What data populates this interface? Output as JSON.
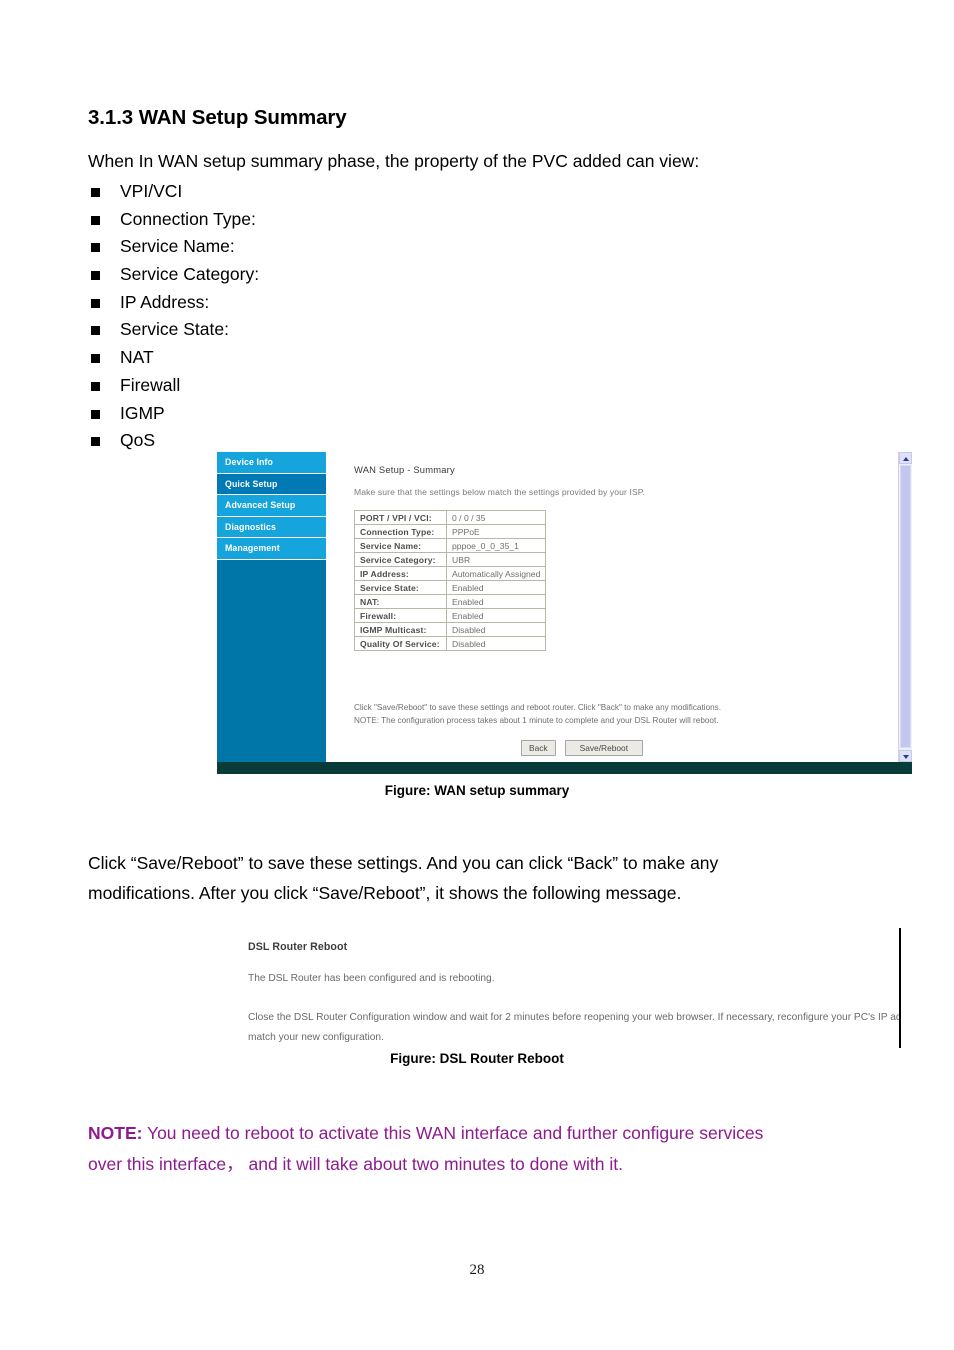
{
  "document": {
    "heading": "3.1.3 WAN Setup Summary",
    "intro": "When In WAN setup summary phase, the property of the PVC added can view:",
    "bullets": [
      "VPI/VCI",
      "Connection Type:",
      "Service Name:",
      "Service Category:",
      "IP Address:",
      "Service State:",
      "NAT",
      "Firewall",
      "IGMP",
      "QoS"
    ],
    "figure1_caption": "Figure: WAN setup summary",
    "figure2_caption": "Figure: DSL Router Reboot",
    "paragraph_line1": "Click “Save/Reboot” to save these settings. And you can click “Back” to make any",
    "paragraph_line2": "modifications. After you click “Save/Reboot”, it shows the following message.",
    "note_label": "NOTE:",
    "note_line1": "You need to reboot to activate this WAN interface and further configure services",
    "note_line2": "over this interface， and it will take about two minutes to done with it.",
    "note_color": "#8e1a8e",
    "page_number": "28"
  },
  "router_ui": {
    "sidebar": {
      "items": [
        {
          "label": "Device Info",
          "selected": false
        },
        {
          "label": "Quick Setup",
          "selected": true
        },
        {
          "label": "Advanced Setup",
          "selected": false
        },
        {
          "label": "Diagnostics",
          "selected": false
        },
        {
          "label": "Management",
          "selected": false
        }
      ],
      "background_color": "#0076a8",
      "item_color": "#16a4dc",
      "selected_color": "#0079b5"
    },
    "pane": {
      "title": "WAN Setup - Summary",
      "subtitle": "Make sure that the settings below match the settings provided by your ISP.",
      "table_rows": [
        {
          "label": "PORT / VPI / VCI:",
          "value": "0 / 0 / 35"
        },
        {
          "label": "Connection Type:",
          "value": "PPPoE"
        },
        {
          "label": "Service Name:",
          "value": "pppoe_0_0_35_1"
        },
        {
          "label": "Service Category:",
          "value": "UBR"
        },
        {
          "label": "IP Address:",
          "value": "Automatically Assigned"
        },
        {
          "label": "Service State:",
          "value": "Enabled"
        },
        {
          "label": "NAT:",
          "value": "Enabled"
        },
        {
          "label": "Firewall:",
          "value": "Enabled"
        },
        {
          "label": "IGMP Multicast:",
          "value": "Disabled"
        },
        {
          "label": "Quality Of Service:",
          "value": "Disabled"
        }
      ],
      "note_line1": "Click \"Save/Reboot\" to save these settings and reboot router. Click \"Back\" to make any modifications.",
      "note_line2": "NOTE: The configuration process takes about 1 minute to complete and your DSL Router will reboot.",
      "back_button": "Back",
      "save_button": "Save/Reboot"
    },
    "scrollbar": {
      "up_icon": "chevron-up-icon",
      "down_icon": "chevron-down-icon"
    }
  },
  "reboot_ui": {
    "title": "DSL Router Reboot",
    "line1": "The DSL Router has been configured and is rebooting.",
    "line2": "Close the DSL Router Configuration window and wait for 2 minutes before reopening your web browser. If necessary, reconfigure",
    "line3": "your PC's IP address to match your new configuration."
  }
}
